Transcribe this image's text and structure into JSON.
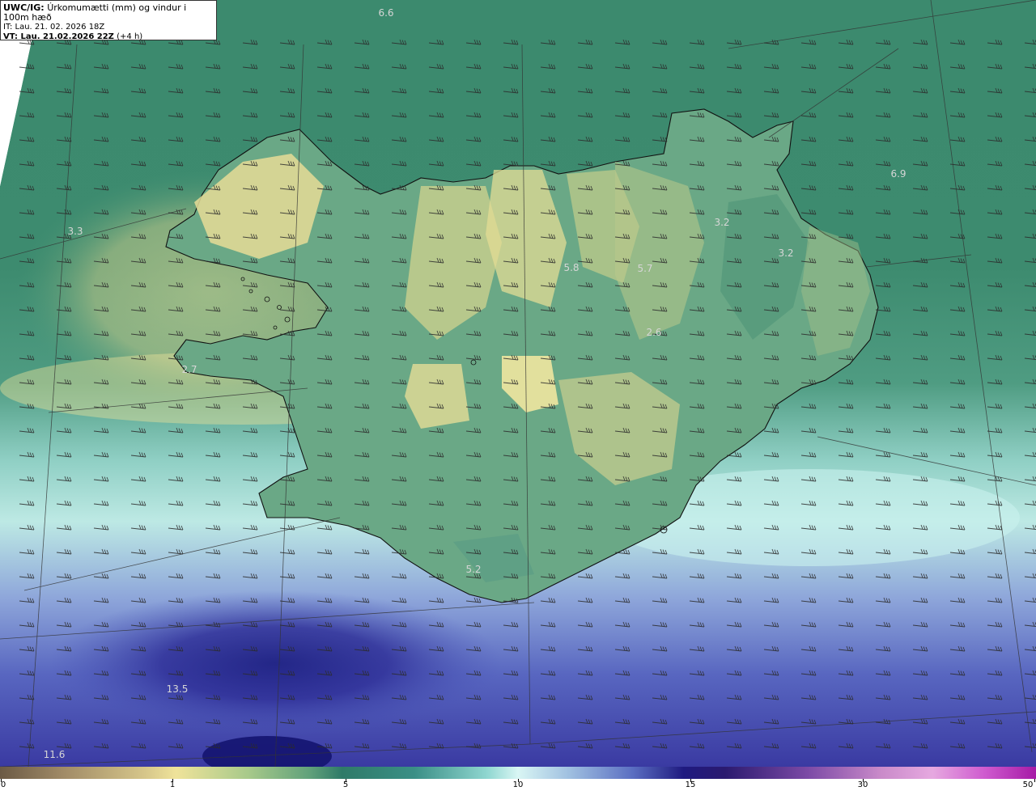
{
  "header": {
    "model": "UWC/IG:",
    "title": "Úrkomumætti (mm) og vindur i 100m hæð",
    "initial_time": "IT: Lau. 21. 02. 2026 18Z",
    "valid_prefix": "VT: Lau. 21.02.2026 22Z",
    "valid_suffix": "(+4 h)"
  },
  "map_values": [
    {
      "id": "v1",
      "text": "6.6"
    },
    {
      "id": "v2",
      "text": "6.9"
    },
    {
      "id": "v3",
      "text": "3.3"
    },
    {
      "id": "v4",
      "text": "3.2"
    },
    {
      "id": "v5",
      "text": "3.2"
    },
    {
      "id": "v6",
      "text": "5.8"
    },
    {
      "id": "v7",
      "text": "5.7"
    },
    {
      "id": "v8",
      "text": "2.6"
    },
    {
      "id": "v9",
      "text": "2.7"
    },
    {
      "id": "v10",
      "text": "5.2"
    },
    {
      "id": "v11",
      "text": "13.5"
    },
    {
      "id": "v12",
      "text": "11.6"
    }
  ],
  "colorbar": {
    "ticks": [
      "0",
      "1",
      "5",
      "10",
      "15",
      "30",
      "50"
    ]
  },
  "colors": {
    "land_dry": "#e6dc96",
    "land_mid": "#7fb08a",
    "sea_green": "#2f7a6a",
    "sea_cyan": "#aee8e4",
    "sea_blue": "#5566c0",
    "sea_deep": "#20207a"
  }
}
